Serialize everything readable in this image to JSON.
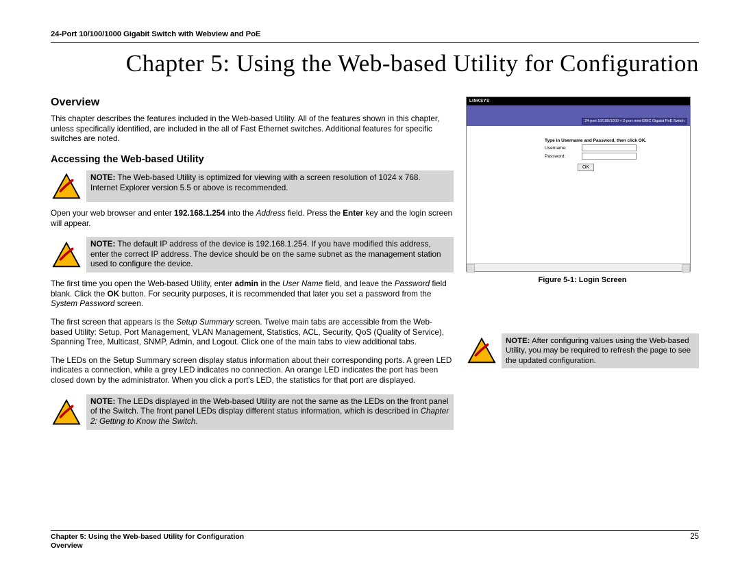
{
  "header": {
    "product": "24-Port 10/100/1000 Gigabit Switch with Webview and PoE"
  },
  "chapter": {
    "title": "Chapter 5: Using the Web-based Utility for Configuration"
  },
  "overview": {
    "heading": "Overview",
    "p1": "This chapter describes the features included in the Web-based Utility. All of the features shown in this chapter, unless specifically identified, are included in the all of Fast Ethernet switches. Additional features for specific switches are noted."
  },
  "access": {
    "heading": "Accessing the Web-based Utility",
    "note1": {
      "label": "NOTE:",
      "text": " The Web-based Utility is optimized for viewing with a screen resolution of 1024 x 768. Internet Explorer version 5.5 or above is recommended."
    },
    "p_open_pre": "Open your web browser and enter ",
    "p_open_ip": "192.168.1.254",
    "p_open_mid": " into the ",
    "p_open_addr": "Address",
    "p_open_mid2": " field. Press the ",
    "p_open_enter": "Enter",
    "p_open_end": " key and the login screen will appear.",
    "note2": {
      "label": "NOTE:",
      "text": " The default IP address of the device is 192.168.1.254. If you have modified this address, enter the correct IP address. The device should be on the same subnet as the management station used to configure the device."
    },
    "p_first_pre": "The first time you open the Web-based Utility, enter ",
    "p_first_admin": "admin",
    "p_first_mid": " in the ",
    "p_first_user": "User Name",
    "p_first_mid2": " field, and leave the ",
    "p_first_pw": "Password",
    "p_first_mid3": " field blank. Click the ",
    "p_first_ok": "OK",
    "p_first_mid4": " button. For security purposes, it is recommended that later you set a password from the ",
    "p_first_sys": "System Password",
    "p_first_end": " screen.",
    "p_setup_pre": "The first screen that appears is the ",
    "p_setup_ss": "Setup Summary",
    "p_setup_end": " screen. Twelve main tabs are accessible from the Web-based Utility: Setup, Port Management, VLAN Management, Statistics, ACL, Security, QoS (Quality of Service), Spanning Tree, Multicast, SNMP, Admin, and Logout. Click one of the main tabs to view additional tabs.",
    "p_leds": "The LEDs on the Setup Summary screen display status information about their corresponding ports. A green LED indicates a connection, while a grey LED indicates no connection. An orange LED indicates the port has been closed down by the administrator. When you click a port's LED, the statistics for that port are displayed.",
    "note3": {
      "label": "NOTE:",
      "text": " The LEDs displayed in the Web-based Utility are not the same as the LEDs on the front panel of the Switch. The front panel LEDs display different status information, which is described in ",
      "ref": "Chapter 2: Getting to Know the Switch",
      "period": "."
    }
  },
  "figure": {
    "brand": "LINKSYS",
    "banner": "24-port 10/100/1000 + 2-port mini-GBIC Gigabit PoE Switch",
    "prompt": "Type in Username and Password, then click OK.",
    "username": "Username:",
    "password": "Password:",
    "ok": "OK",
    "caption": "Figure 5-1: Login Screen"
  },
  "right_note": {
    "label": "NOTE:",
    "text": " After configuring values using the Web-based Utility, you may be required to refresh the page to see the updated configuration."
  },
  "footer": {
    "line1": "Chapter 5: Using the Web-based Utility for Configuration",
    "line2": "Overview",
    "page": "25"
  }
}
